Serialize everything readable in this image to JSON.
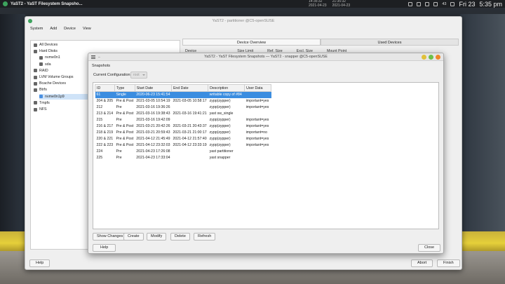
{
  "topbar": {
    "app_title": "YaST2 - YaST Filesystem Snapsho...",
    "center_lines": [
      "14:35:32",
      "21:35:32",
      "...",
      "2021-04-23",
      "2021-04-23"
    ],
    "date": "Fri 23",
    "time": "5:35 pm",
    "temp": "43"
  },
  "main_window": {
    "title": "YaST2 - partitioner @C5-openSUSE",
    "menu": [
      "System",
      "Add",
      "Device",
      "View"
    ],
    "tree": [
      {
        "label": "All Devices",
        "indent": 0,
        "selected": false
      },
      {
        "label": "Hard Disks",
        "indent": 0,
        "selected": false
      },
      {
        "label": "nvme0n1",
        "indent": 1,
        "selected": false
      },
      {
        "label": "sda",
        "indent": 1,
        "selected": false
      },
      {
        "label": "RAID",
        "indent": 0,
        "selected": false
      },
      {
        "label": "LVM Volume Groups",
        "indent": 0,
        "selected": false
      },
      {
        "label": "Bcache Devices",
        "indent": 0,
        "selected": false
      },
      {
        "label": "Btrfs",
        "indent": 0,
        "selected": false
      },
      {
        "label": "nvme0n1p9",
        "indent": 1,
        "selected": true
      },
      {
        "label": "Tmpfs",
        "indent": 0,
        "selected": false
      },
      {
        "label": "NFS",
        "indent": 0,
        "selected": false
      }
    ],
    "tabs": [
      {
        "label": "Device Overview",
        "active": true
      },
      {
        "label": "Used Devices",
        "active": false
      }
    ],
    "device_columns": [
      "Device",
      "Size Limit",
      "Ref. Size",
      "Excl. Size",
      "Mount Point"
    ],
    "help_label": "Help",
    "abort_label": "Abort",
    "finish_label": "Finish"
  },
  "snapshot_dialog": {
    "title": "YaST2 - YaST Filesystem Snapshots — YaST2 - snapper @C5-openSUSE",
    "heading": "Snapshots",
    "config_label": "Current Configuration",
    "config_value": "root",
    "columns": [
      "ID",
      "Type",
      "Start Date",
      "End Date",
      "Description",
      "User Data"
    ],
    "rows": [
      {
        "id": "61",
        "type": "Single",
        "start": "2020-06-23 15:41:54",
        "end": "",
        "desc": "writable copy of #84",
        "user": "",
        "selected": true
      },
      {
        "id": "204 & 205",
        "type": "Pre & Post",
        "start": "2021-03-05 10:54:19",
        "end": "2021-03-05 10:58:17",
        "desc": "zypp(zypper)",
        "user": "important=yes",
        "selected": false
      },
      {
        "id": "212",
        "type": "Pre",
        "start": "2021-03-16 19:36:26",
        "end": "",
        "desc": "zypp(zypper)",
        "user": "important=yes",
        "selected": false
      },
      {
        "id": "213 & 214",
        "type": "Pre & Post",
        "start": "2021-03-16 19:38:43",
        "end": "2021-03-16 19:41:21",
        "desc": "yast sw_single",
        "user": "",
        "selected": false
      },
      {
        "id": "215",
        "type": "Pre",
        "start": "2021-03-16 19:42:09",
        "end": "",
        "desc": "zypp(zypper)",
        "user": "important=yes",
        "selected": false
      },
      {
        "id": "216 & 217",
        "type": "Pre & Post",
        "start": "2021-03-21 20:42:26",
        "end": "2021-03-21 20:43:37",
        "desc": "zypp(zypper)",
        "user": "important=yes",
        "selected": false
      },
      {
        "id": "218 & 219",
        "type": "Pre & Post",
        "start": "2021-03-21 20:59:43",
        "end": "2021-03-21 21:00:17",
        "desc": "zypp(zypper)",
        "user": "important=no",
        "selected": false
      },
      {
        "id": "220 & 221",
        "type": "Pre & Post",
        "start": "2021-04-12 21:45:49",
        "end": "2021-04-12 21:57:40",
        "desc": "zypp(zypper)",
        "user": "important=yes",
        "selected": false
      },
      {
        "id": "222 & 223",
        "type": "Pre & Post",
        "start": "2021-04-12 23:32:03",
        "end": "2021-04-12 23:33:19",
        "desc": "zypp(zypper)",
        "user": "important=yes",
        "selected": false
      },
      {
        "id": "224",
        "type": "Pre",
        "start": "2021-04-23 17:26:08",
        "end": "",
        "desc": "yast partitioner",
        "user": "",
        "selected": false
      },
      {
        "id": "225",
        "type": "Pre",
        "start": "2021-04-23 17:33:04",
        "end": "",
        "desc": "yast snapper",
        "user": "",
        "selected": false
      }
    ],
    "buttons": {
      "show_changes": "Show Changes",
      "create": "Create",
      "modify": "Modify",
      "delete": "Delete",
      "refresh": "Refresh",
      "help": "Help",
      "close": "Close"
    },
    "selection_color": "#3b8de0"
  }
}
